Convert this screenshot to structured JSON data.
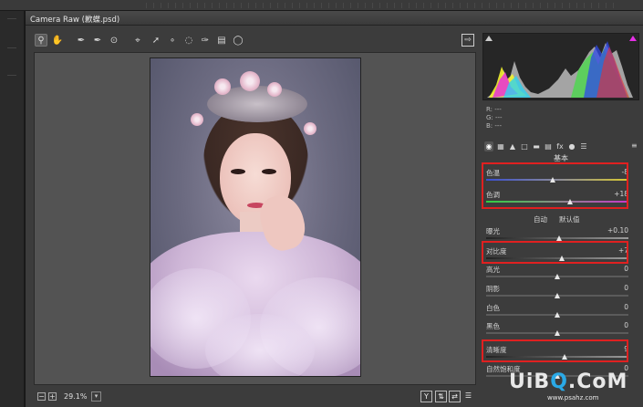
{
  "window": {
    "title": "Camera Raw (歉蝶.psd)"
  },
  "toolbar": {
    "tools": [
      "zoom-tool",
      "hand-tool",
      "white-balance-tool",
      "color-sampler-tool",
      "targeted-adjustment-tool",
      "crop-tool",
      "straighten-tool",
      "spot-removal-tool",
      "red-eye-tool",
      "adjustment-brush",
      "graduated-filter",
      "radial-filter"
    ],
    "save_icon": "save-icon"
  },
  "histogram": {
    "rgb_r": "R:  ---",
    "rgb_g": "G:  ---",
    "rgb_b": "B:  ---"
  },
  "panel": {
    "section_title": "基本",
    "auto_label": "自动",
    "default_label": "默认值",
    "menu_icon": "≡"
  },
  "sliders": [
    {
      "key": "temperature",
      "label": "色温",
      "value": "-8",
      "level": 0.47
    },
    {
      "key": "tint",
      "label": "色调",
      "value": "+18",
      "level": 0.59
    },
    {
      "key": "exposure",
      "label": "曝光",
      "value": "+0.10",
      "level": 0.51
    },
    {
      "key": "contrast",
      "label": "对比度",
      "value": "+7",
      "level": 0.53
    },
    {
      "key": "highlights",
      "label": "高光",
      "value": "0",
      "level": 0.5
    },
    {
      "key": "shadows",
      "label": "阴影",
      "value": "0",
      "level": 0.5
    },
    {
      "key": "whites",
      "label": "白色",
      "value": "0",
      "level": 0.5
    },
    {
      "key": "blacks",
      "label": "黑色",
      "value": "0",
      "level": 0.5
    },
    {
      "key": "clarity",
      "label": "清晰度",
      "value": "9",
      "level": 0.55
    },
    {
      "key": "vibrance",
      "label": "自然饱和度",
      "value": "0",
      "level": 0.5
    }
  ],
  "status": {
    "zoom": "29.1%"
  },
  "watermark": {
    "brand_u": "UiB",
    "brand_q": "Q",
    "brand_com": ".CoM",
    "sub": "www.psahz.com"
  },
  "colors": {
    "highlight": "#e02020",
    "temp_track_start": "#3a4fd0",
    "temp_track_end": "#d8c830",
    "tint_track_start": "#2fd040",
    "tint_track_end": "#c838c8"
  }
}
